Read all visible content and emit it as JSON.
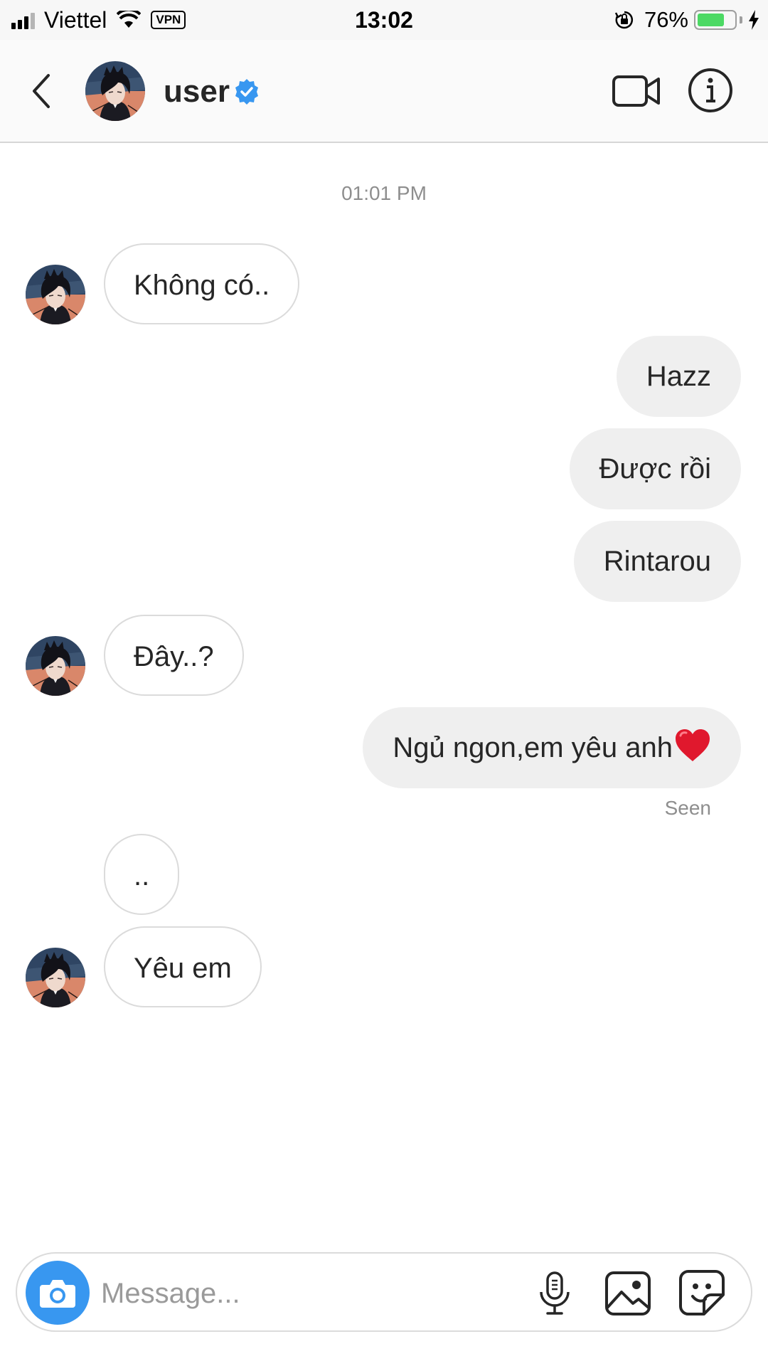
{
  "status_bar": {
    "carrier": "Viettel",
    "vpn": "VPN",
    "time": "13:02",
    "battery_percent": "76%",
    "battery_level": 0.76,
    "icons": [
      "signal-icon",
      "wifi-icon",
      "orientation-lock-icon",
      "battery-icon",
      "charging-bolt-icon"
    ]
  },
  "header": {
    "username": "user",
    "verified": true,
    "icons": [
      "back-chevron-icon",
      "verified-badge-icon",
      "video-call-icon",
      "info-icon"
    ]
  },
  "chat": {
    "timestamp": "01:01 PM",
    "messages": [
      {
        "from": "them",
        "text": "Không có.."
      },
      {
        "from": "me",
        "text": "Hazz"
      },
      {
        "from": "me",
        "text": "Được rồi"
      },
      {
        "from": "me",
        "text": "Rintarou"
      },
      {
        "from": "them",
        "text": "Đây..?"
      },
      {
        "from": "me",
        "text": "Ngủ ngon,em yêu anh",
        "emoji": "red-heart"
      },
      {
        "from": "them",
        "text": ".."
      },
      {
        "from": "them",
        "text": "Yêu em"
      }
    ],
    "seen_label": "Seen"
  },
  "composer": {
    "placeholder": "Message...",
    "value": "",
    "icons": [
      "camera-icon",
      "microphone-icon",
      "gallery-icon",
      "sticker-icon"
    ]
  },
  "colors": {
    "accent_blue": "#3897f0",
    "bubble_out": "#efefef",
    "bubble_in_border": "#dbdbdb",
    "battery_green": "#4cd964",
    "heart_red": "#e0182d"
  }
}
